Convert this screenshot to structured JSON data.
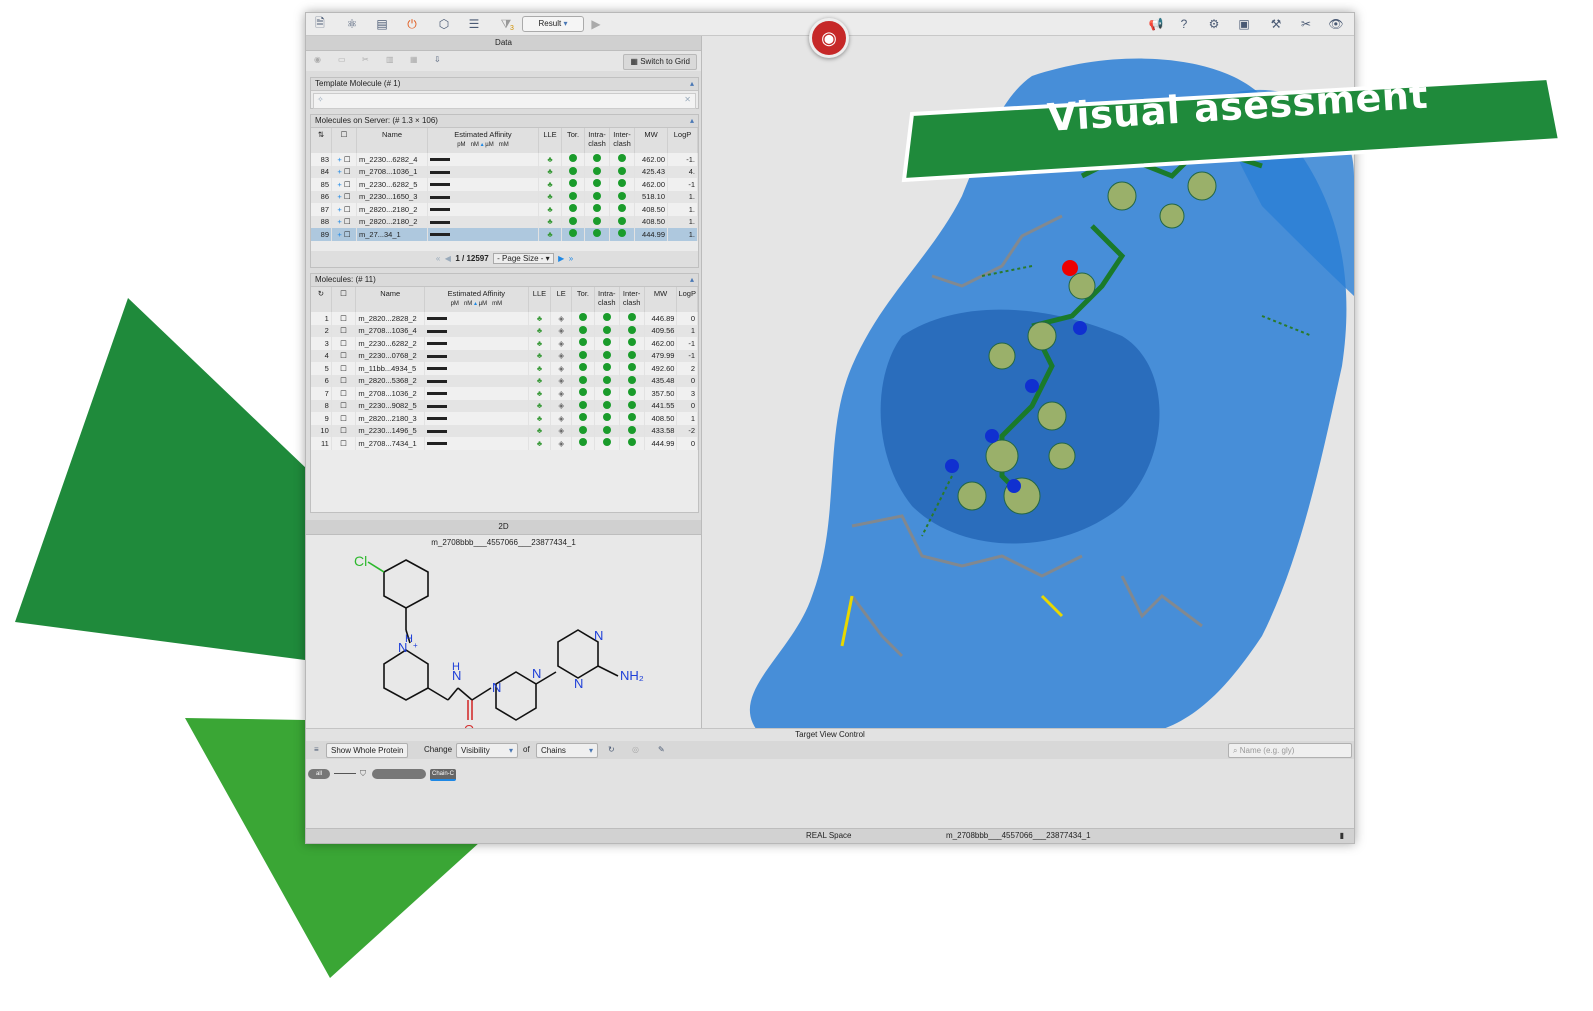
{
  "colors": {
    "brand_green": "#1f8a3b",
    "accent_blue": "#1e88e5",
    "status_green": "#1a9c2b",
    "protein_surface": "#2b7fd6"
  },
  "banner": {
    "text": "Visual asessment"
  },
  "toolbar": {
    "result_label": "Result",
    "badge": "3"
  },
  "data_header": "Data",
  "switch_grid": "Switch to Grid",
  "template": {
    "title": "Template Molecule  (# 1)"
  },
  "server": {
    "title": "Molecules on Server:  (# 1.3 × 106)",
    "columns": [
      "Name",
      "Estimated Affinity",
      "LLE",
      "Tor.",
      "Intra-clash",
      "Inter-clash",
      "MW",
      "LogP"
    ],
    "units": [
      "pM",
      "nM",
      "µM",
      "mM"
    ],
    "rows": [
      {
        "n": "83",
        "name": "m_2230...6282_4",
        "mw": "462.00",
        "logp": "-1."
      },
      {
        "n": "84",
        "name": "m_2708...1036_1",
        "mw": "425.43",
        "logp": "4."
      },
      {
        "n": "85",
        "name": "m_2230...6282_5",
        "mw": "462.00",
        "logp": "-1"
      },
      {
        "n": "86",
        "name": "m_2230...1650_3",
        "mw": "518.10",
        "logp": "1."
      },
      {
        "n": "87",
        "name": "m_2820...2180_2",
        "mw": "408.50",
        "logp": "1."
      },
      {
        "n": "88",
        "name": "m_2820...2180_2",
        "mw": "408.50",
        "logp": "1."
      },
      {
        "n": "89",
        "name": "m_27...34_1",
        "mw": "444.99",
        "logp": "1."
      }
    ],
    "page": "1 / 12597",
    "page_size": "- Page Size -"
  },
  "molecules": {
    "title": "Molecules:  (# 11)",
    "columns": [
      "Name",
      "Estimated Affinity",
      "LLE",
      "LE",
      "Tor.",
      "Intra-clash",
      "Inter-clash",
      "MW",
      "LogP"
    ],
    "rows": [
      {
        "n": "1",
        "name": "m_2820...2828_2",
        "mw": "446.89",
        "logp": "0"
      },
      {
        "n": "2",
        "name": "m_2708...1036_4",
        "mw": "409.56",
        "logp": "1"
      },
      {
        "n": "3",
        "name": "m_2230...6282_2",
        "mw": "462.00",
        "logp": "-1"
      },
      {
        "n": "4",
        "name": "m_2230...0768_2",
        "mw": "479.99",
        "logp": "-1"
      },
      {
        "n": "5",
        "name": "m_11bb...4934_5",
        "mw": "492.60",
        "logp": "2"
      },
      {
        "n": "6",
        "name": "m_2820...5368_2",
        "mw": "435.48",
        "logp": "0"
      },
      {
        "n": "7",
        "name": "m_2708...1036_2",
        "mw": "357.50",
        "logp": "3"
      },
      {
        "n": "8",
        "name": "m_2230...9082_5",
        "mw": "441.55",
        "logp": "0"
      },
      {
        "n": "9",
        "name": "m_2820...2180_3",
        "mw": "408.50",
        "logp": "1"
      },
      {
        "n": "10",
        "name": "m_2230...1496_5",
        "mw": "433.58",
        "logp": "-2"
      },
      {
        "n": "11",
        "name": "m_2708...7434_1",
        "mw": "444.99",
        "logp": "0"
      }
    ]
  },
  "panel2d": {
    "header": "2D",
    "molecule_name": "m_2708bbb___4557066___23877434_1",
    "atoms": {
      "cl": "Cl",
      "nh": "H",
      "n": "N",
      "nplus": "+",
      "nh2": "NH₂",
      "o": "O"
    }
  },
  "tvc": {
    "title": "Target View Control",
    "show_whole_protein": "Show Whole Protein",
    "change": "Change",
    "visibility": "Visibility",
    "of": "of",
    "chains": "Chains",
    "search_placeholder": "Name (e.g. gly)",
    "chip_all": "all",
    "chip_chain": "Chain-C"
  },
  "status": {
    "space": "REAL Space",
    "molecule": "m_2708bbb___4557066___23877434_1"
  }
}
